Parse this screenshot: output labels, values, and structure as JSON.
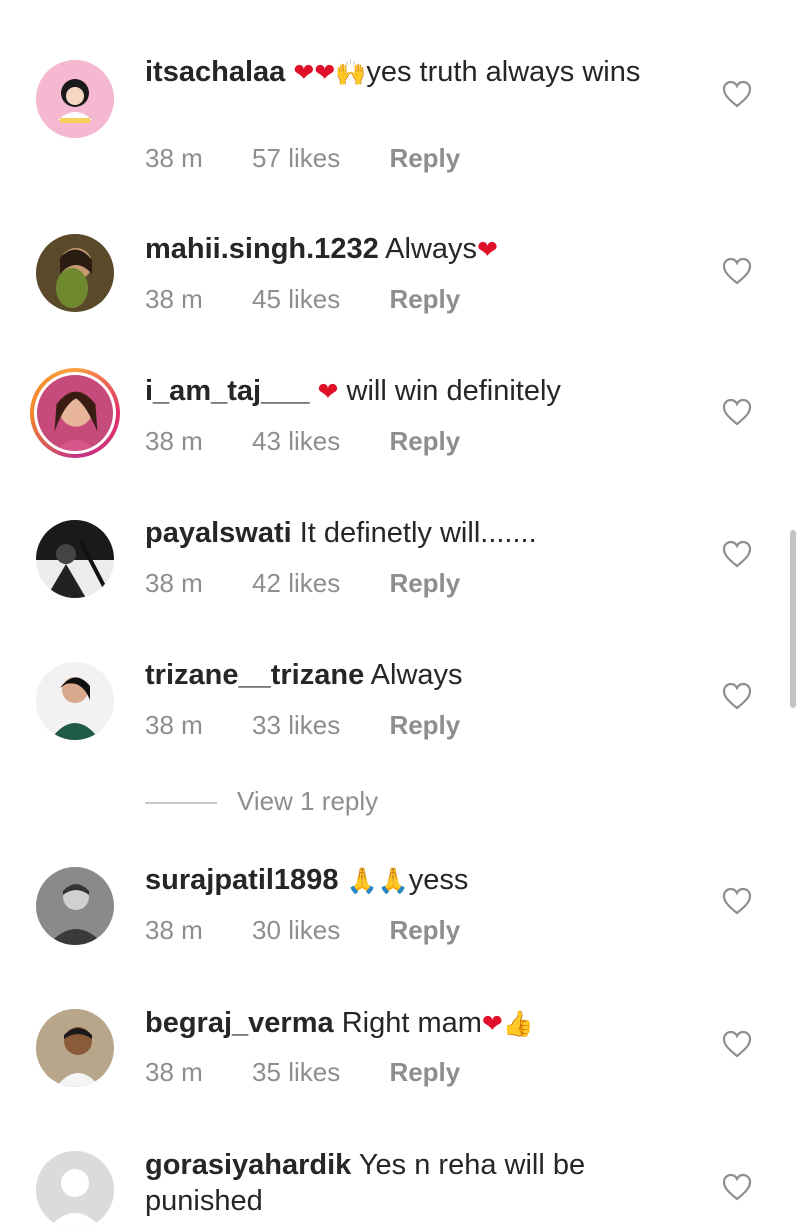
{
  "comments": [
    {
      "username": "itsachalaa",
      "emoji": "❤❤🙌",
      "text": "yes truth always wins",
      "time": "38 m",
      "likes": "57 likes",
      "reply": "Reply"
    },
    {
      "username": "mahii.singh.1232",
      "text": "Always",
      "emoji": "❤",
      "time": "38 m",
      "likes": "45 likes",
      "reply": "Reply"
    },
    {
      "username": "i_am_taj___",
      "emoji": "❤",
      "text": "will win definitely",
      "time": "38 m",
      "likes": "43 likes",
      "reply": "Reply"
    },
    {
      "username": "payalswati",
      "text": "It definetly will.......",
      "time": "38 m",
      "likes": "42 likes",
      "reply": "Reply"
    },
    {
      "username": "trizane__trizane",
      "text": "Always",
      "time": "38 m",
      "likes": "33 likes",
      "reply": "Reply"
    },
    {
      "username": "surajpatil1898",
      "emoji": "🙏🙏",
      "text": "yess",
      "time": "38 m",
      "likes": "30 likes",
      "reply": "Reply"
    },
    {
      "username": "begraj_verma",
      "text": "Right mam",
      "emoji": "❤👍",
      "time": "38 m",
      "likes": "35 likes",
      "reply": "Reply"
    },
    {
      "username": "gorasiyahardik",
      "text": "Yes n reha will be punished"
    }
  ],
  "view_replies": "View 1 reply",
  "icons": {
    "like": "heart-outline-icon"
  },
  "colors": {
    "text": "#262626",
    "muted": "#8e8e8e",
    "heart": "#e0102a"
  }
}
